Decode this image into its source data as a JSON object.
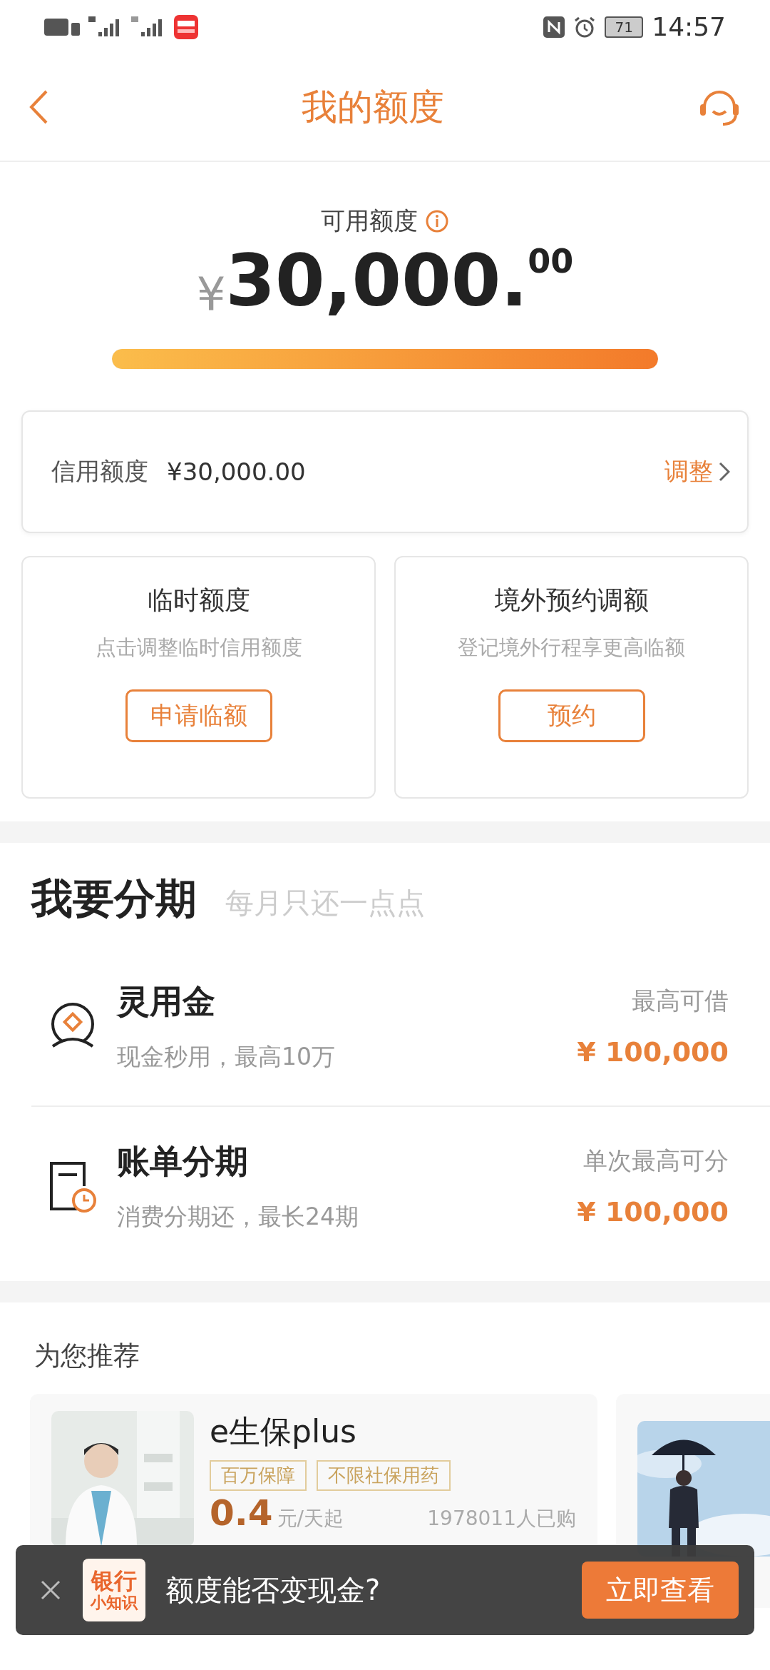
{
  "status_bar": {
    "battery": "71",
    "time": "14:57"
  },
  "header": {
    "title": "我的额度"
  },
  "available": {
    "label": "可用额度",
    "currency": "¥",
    "integer": "30,000.",
    "decimal": "00",
    "level": 1
  },
  "credit_limit": {
    "label": "信用额度",
    "value": "¥30,000.00",
    "action": "调整"
  },
  "cards": [
    {
      "title": "临时额度",
      "subtitle": "点击调整临时信用额度",
      "button": "申请临额"
    },
    {
      "title": "境外预约调额",
      "subtitle": "登记境外行程享更高临额",
      "button": "预约"
    }
  ],
  "installment": {
    "title": "我要分期",
    "subtitle": "每月只还一点点",
    "items": [
      {
        "kind": "cash",
        "name": "灵用金",
        "desc": "现金秒用，最高10万",
        "caption": "最高可借",
        "amount": "¥ 100,000"
      },
      {
        "kind": "bill",
        "name": "账单分期",
        "desc": "消费分期还，最长24期",
        "caption": "单次最高可分",
        "amount": "¥ 100,000"
      }
    ]
  },
  "recommend": {
    "title": "为您推荐",
    "products": [
      {
        "kind": "product",
        "name": "e生保plus",
        "tags": [
          "百万保障",
          "不限社保用药"
        ],
        "price": "0.4",
        "unit": "元/天起",
        "sold": "1978011人已购"
      },
      {
        "kind": "partial"
      }
    ]
  },
  "banner": {
    "logo_lines": [
      "银行",
      "小知识"
    ],
    "text": "额度能否变现金?",
    "button": "立即查看"
  }
}
